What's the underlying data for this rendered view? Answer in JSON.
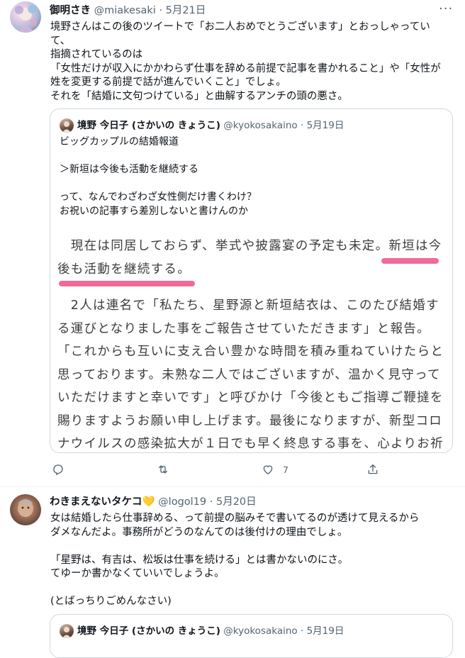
{
  "tweets": [
    {
      "name": "御明さき",
      "handle": "@miakesaki",
      "date": "5月21日",
      "text": "境野さんはこの後のツイートで「お二人おめでとうございます」とおっしゃってい\nて、\n指摘されているのは\n「女性だけが収入にかかわらず仕事を辞める前提で記事を書かれること」や「女性が\n姓を変更する前提で話が進んでいくこと」でしょ。\nそれを「結婚に文句つけている」と曲解するアンチの頭の悪さ。",
      "quote": {
        "name": "境野 今日子 (さかいの きょうこ)",
        "handle": "@kyokosakaino",
        "date": "5月19日",
        "text": "ビッグカップルの結婚報道\n\n＞新垣は今後も活動を継続する\n\nって、なんでわざわざ女性側だけ書くわけ？\nお祝いの記事すら差別しないと書けんのか",
        "article": [
          "　現在は同居しておらず、挙式や披露宴の予定も未定。新垣は今後も活動を継続する。",
          "　2人は連名で「私たち、星野源と新垣結衣は、このたび結婚する運びとなりました事をご報告させていただきます」と報告。「これからも互いに支え合い豊かな時間を積み重ねていけたらと思っております。未熟な二人ではございますが、温かく見守っていただけますと幸いです」と呼びかけ「今後ともご指導ご鞭撻を賜りますようお願い申し上げます。最後になりますが、新型コロナウイルスの感染拡大が１日でも早く終息する事を、心よりお祈"
        ]
      },
      "actions": {
        "reply": "",
        "retweet": "",
        "like": "7",
        "share": ""
      }
    },
    {
      "name": "わきまえないタケコ💛",
      "handle": "@logol19",
      "date": "5月20日",
      "text": "女は結婚したら仕事辞める、って前提の脳みそで書いてるのが透けて見えるから\nダメなんだよ。事務所がどうのなんてのは後付けの理由でしょ。\n\n「星野は、有吉は、松坂は仕事を続ける」とは書かないのにさ。\nてゆーか書かなくていいでしょうよ。\n\n(とばっちりごめんなさい)",
      "quote": {
        "name": "境野 今日子 (さかいの きょうこ)",
        "handle": "@kyokosakaino",
        "date": "5月19日"
      }
    }
  ],
  "icons": {
    "more": "more-dots-icon",
    "reply": "reply-icon",
    "retweet": "retweet-icon",
    "like": "heart-icon",
    "share": "share-icon"
  },
  "colors": {
    "text": "#0f1419",
    "secondary": "#536471",
    "border": "#cfd9de",
    "highlight": "#f06a9a"
  }
}
